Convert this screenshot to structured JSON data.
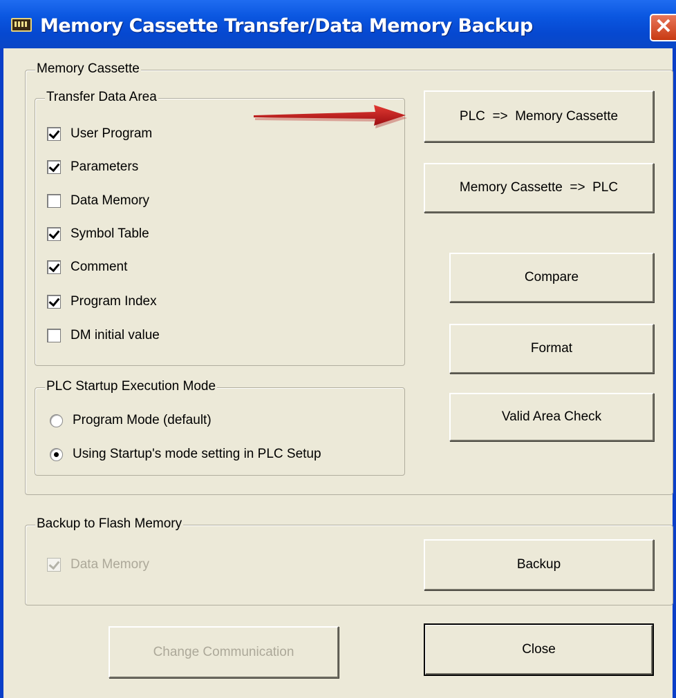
{
  "window": {
    "title": "Memory Cassette Transfer/Data Memory Backup",
    "close_glyph": "✕"
  },
  "memory_cassette": {
    "label": "Memory Cassette",
    "transfer_area": {
      "label": "Transfer Data Area",
      "items": [
        {
          "label": "User Program",
          "checked": true
        },
        {
          "label": "Parameters",
          "checked": true
        },
        {
          "label": "Data Memory",
          "checked": false
        },
        {
          "label": "Symbol Table",
          "checked": true
        },
        {
          "label": "Comment",
          "checked": true
        },
        {
          "label": "Program Index",
          "checked": true
        },
        {
          "label": "DM initial value",
          "checked": false
        }
      ]
    },
    "startup_mode": {
      "label": "PLC Startup Execution Mode",
      "options": [
        {
          "label": "Program Mode (default)",
          "selected": false
        },
        {
          "label": "Using Startup's mode setting in PLC Setup",
          "selected": true
        }
      ]
    },
    "buttons": {
      "plc_to_cassette": "PLC  =>  Memory Cassette",
      "cassette_to_plc": "Memory Cassette  =>  PLC",
      "compare": "Compare",
      "format": "Format",
      "valid_area_check": "Valid Area Check"
    }
  },
  "flash_backup": {
    "label": "Backup to Flash Memory",
    "data_memory": {
      "label": "Data Memory",
      "checked": true,
      "disabled": true
    },
    "backup_button": "Backup"
  },
  "footer": {
    "change_comm_button": "Change Communication",
    "close_button": "Close"
  },
  "colors": {
    "titlebar": "#0a56e0",
    "dialog_bg": "#ece9d8",
    "annotation_arrow": "#c0161a"
  }
}
